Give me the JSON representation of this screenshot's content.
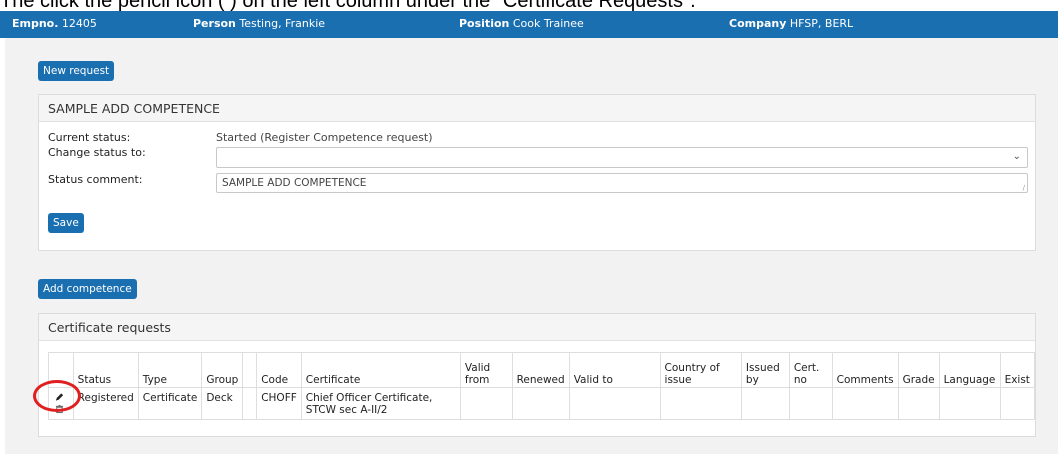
{
  "instruction": "The click the pencil icon (      ) on the left column under the \"Certificate Requests\".",
  "topbar": {
    "empno_label": "Empno.",
    "empno_value": "12405",
    "person_label": "Person",
    "person_value": "Testing, Frankie",
    "position_label": "Position",
    "position_value": "Cook Trainee",
    "company_label": "Company",
    "company_value": "HFSP, BERL"
  },
  "new_request_label": "New request",
  "request_panel": {
    "title": "SAMPLE ADD COMPETENCE",
    "current_status_label": "Current status:",
    "current_status_value": "Started (Register Competence request)",
    "change_status_label": "Change status to:",
    "change_status_value": "",
    "status_comment_label": "Status comment:",
    "status_comment_value": "SAMPLE ADD COMPETENCE",
    "save_label": "Save"
  },
  "add_competence_label": "Add competence",
  "cert_panel": {
    "title": "Certificate requests",
    "headers": [
      "",
      "Status",
      "Type",
      "Group",
      "",
      "Code",
      "Certificate",
      "Valid from",
      "Renewed",
      "Valid to",
      "Country of issue",
      "Issued by",
      "Cert. no",
      "Comments",
      "Grade",
      "Language",
      "Exist"
    ],
    "rows": [
      {
        "status": "Registered",
        "type": "Certificate",
        "group": "Deck",
        "blank": "",
        "code": "CHOFF",
        "certificate": "Chief Officer Certificate, STCW sec A-II/2",
        "valid_from": "",
        "renewed": "",
        "valid_to": "",
        "country": "",
        "issued_by": "",
        "cert_no": "",
        "comments": "",
        "grade": "",
        "language": "",
        "exist": ""
      }
    ]
  },
  "icons": {
    "edit": "pencil-icon",
    "delete": "trash-icon",
    "dropdown": "chevron-down-icon",
    "highlight_color": "#e02020",
    "brand_color": "#1a6fb0"
  }
}
